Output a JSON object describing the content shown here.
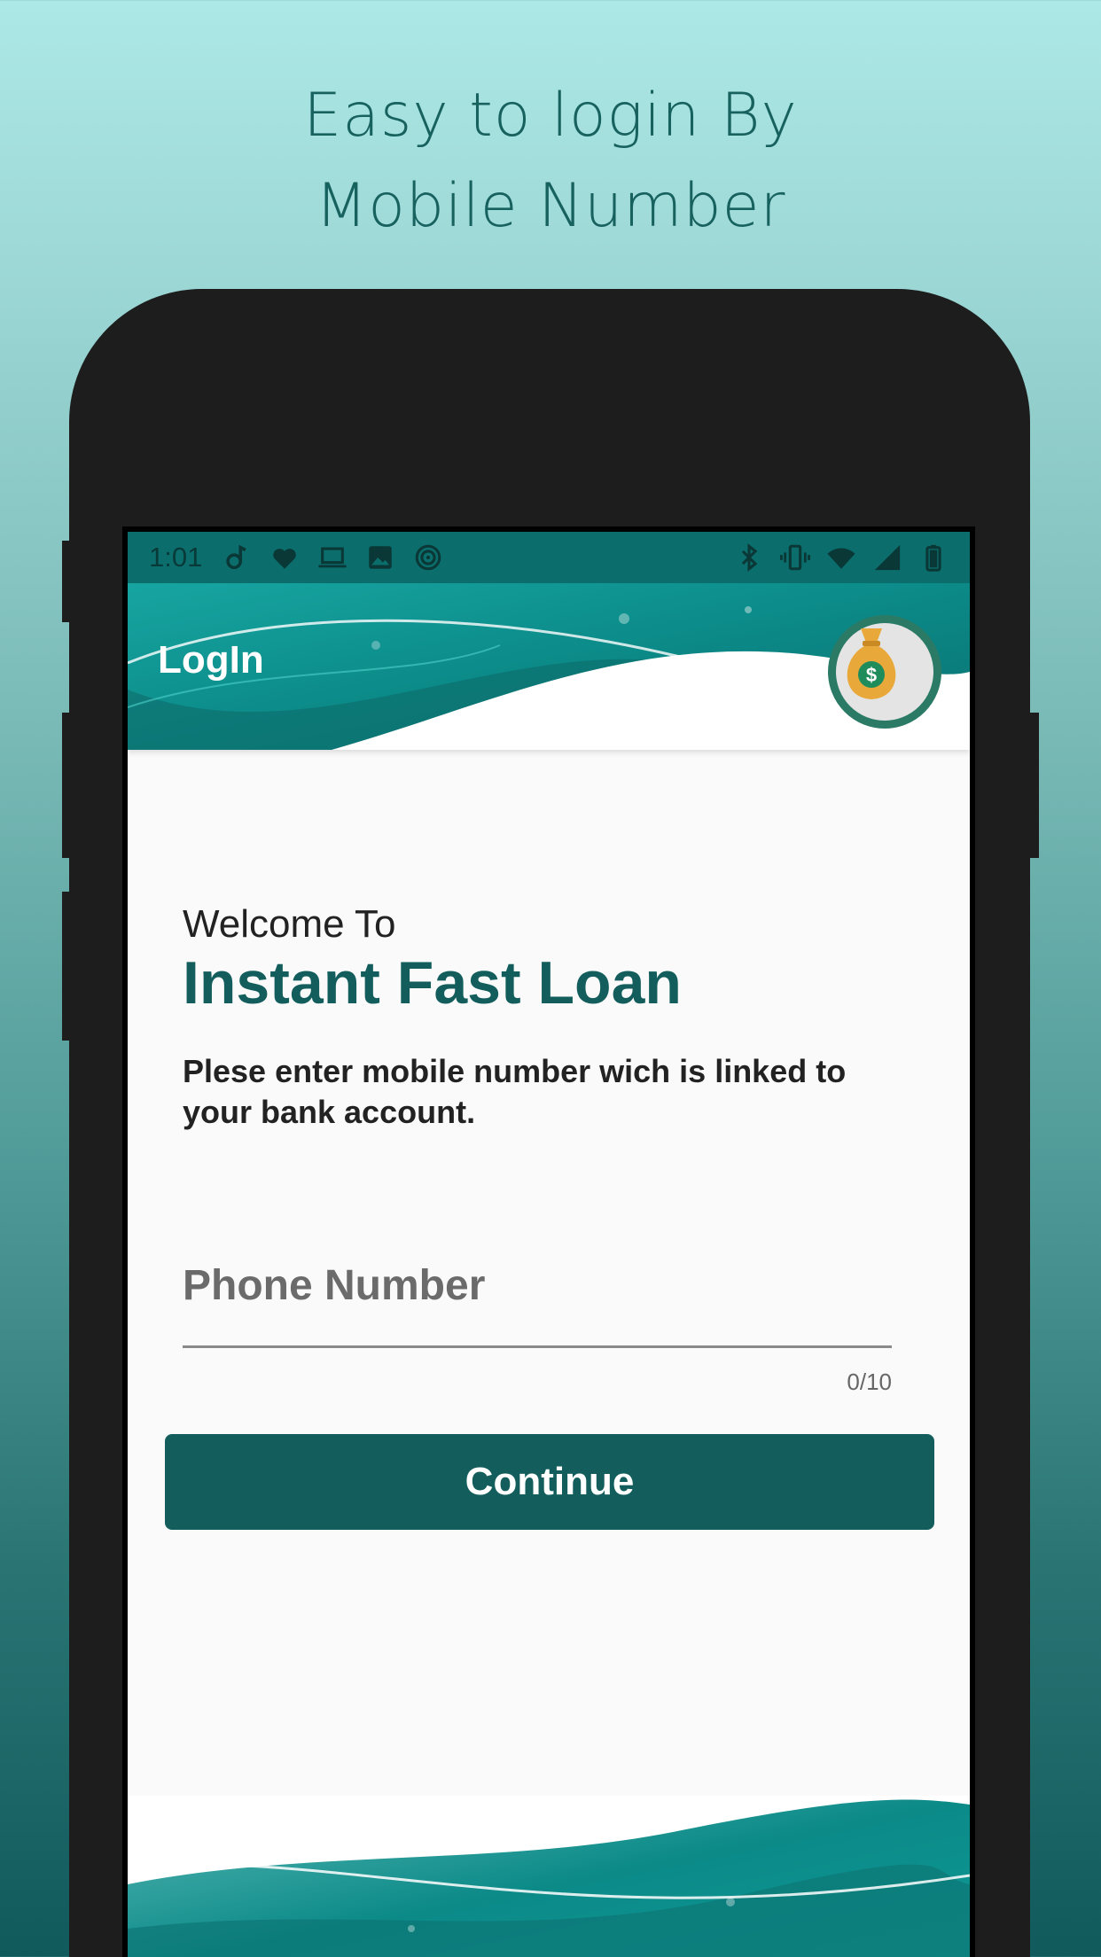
{
  "promo": {
    "line1": "Easy to login By",
    "line2": "Mobile Number"
  },
  "status_bar": {
    "time": "1:01",
    "left_icons": [
      "music-icon",
      "heart-icon",
      "laptop-icon",
      "image-icon",
      "wifi-signal-icon"
    ],
    "right_icons": [
      "bluetooth-icon",
      "vibrate-icon",
      "wifi-icon",
      "cell-signal-icon",
      "battery-icon"
    ]
  },
  "header": {
    "title": "LogIn",
    "logo_icon": "money-bag-icon"
  },
  "content": {
    "welcome": "Welcome To",
    "app_name": "Instant Fast Loan",
    "description": "Plese enter mobile number wich is linked to your bank account.",
    "phone_placeholder": "Phone Number",
    "phone_value": "",
    "counter": "0/10",
    "continue_label": "Continue"
  },
  "colors": {
    "primary": "#135e5d",
    "accent": "#0b8e8c",
    "logo_ring": "#2b7a66",
    "bag": "#e8a93a"
  }
}
